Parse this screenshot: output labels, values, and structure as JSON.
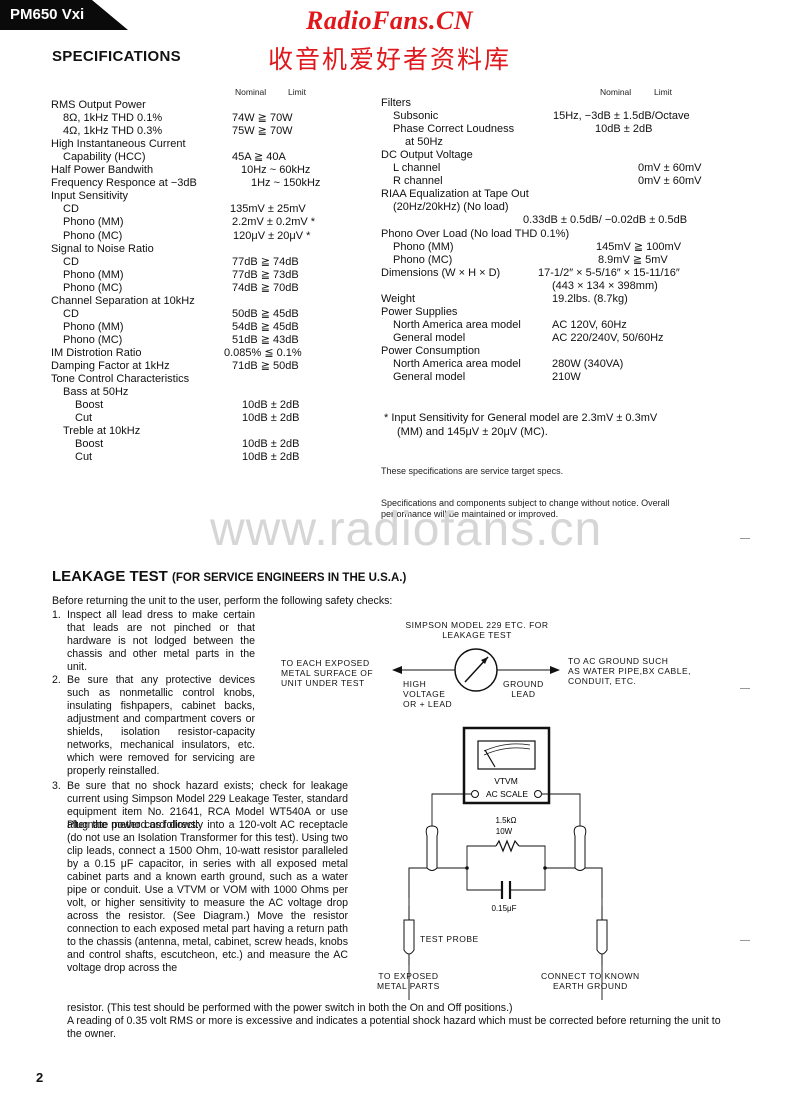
{
  "header": {
    "model": "PM650 Vxi",
    "brand_en": "RadioFans.CN",
    "brand_cn": "收音机爱好者资料库",
    "section_title": "SPECIFICATIONS"
  },
  "columns": {
    "nominal": "Nominal",
    "limit": "Limit"
  },
  "specs_left": [
    {
      "label": "RMS Output Power",
      "value": "",
      "indent": 0
    },
    {
      "label": "8Ω, 1kHz THD 0.1%",
      "value": "74W ≧ 70W",
      "indent": 1
    },
    {
      "label": "4Ω, 1kHz THD 0.3%",
      "value": "75W ≧ 70W",
      "indent": 1
    },
    {
      "label": "High Instantaneous Current",
      "value": "",
      "indent": 0
    },
    {
      "label": "Capability (HCC)",
      "value": "45A ≧ 40A",
      "indent": 1
    },
    {
      "label": "Half Power Bandwith",
      "value": "10Hz ~ 60kHz",
      "indent": 0
    },
    {
      "label": "Frequency Responce at −3dB",
      "value": "1Hz ~ 150kHz",
      "indent": 0
    },
    {
      "label": "Input Sensitivity",
      "value": "",
      "indent": 0
    },
    {
      "label": "CD",
      "value": "135mV ± 25mV",
      "indent": 1
    },
    {
      "label": "Phono (MM)",
      "value": "2.2mV ± 0.2mV *",
      "indent": 1
    },
    {
      "label": "Phono (MC)",
      "value": "120μV ± 20μV *",
      "indent": 1
    },
    {
      "label": "Signal to Noise Ratio",
      "value": "",
      "indent": 0
    },
    {
      "label": "CD",
      "value": "77dB ≧ 74dB",
      "indent": 1
    },
    {
      "label": "Phono (MM)",
      "value": "77dB ≧ 73dB",
      "indent": 1
    },
    {
      "label": "Phono (MC)",
      "value": "74dB ≧ 70dB",
      "indent": 1
    },
    {
      "label": "Channel Separation at 10kHz",
      "value": "",
      "indent": 0
    },
    {
      "label": "CD",
      "value": "50dB ≧ 45dB",
      "indent": 1
    },
    {
      "label": "Phono (MM)",
      "value": "54dB ≧ 45dB",
      "indent": 1
    },
    {
      "label": "Phono (MC)",
      "value": "51dB ≧ 43dB",
      "indent": 1
    },
    {
      "label": "IM Distrotion Ratio",
      "value": "0.085% ≦ 0.1%",
      "indent": 0
    },
    {
      "label": "Damping Factor at 1kHz",
      "value": "71dB ≧ 50dB",
      "indent": 0
    },
    {
      "label": "Tone Control Characteristics",
      "value": "",
      "indent": 0
    },
    {
      "label": "Bass at 50Hz",
      "value": "",
      "indent": 1
    },
    {
      "label": "Boost",
      "value": "10dB ± 2dB",
      "indent": 2
    },
    {
      "label": "Cut",
      "value": "10dB ± 2dB",
      "indent": 2
    },
    {
      "label": "Treble at 10kHz",
      "value": "",
      "indent": 1
    },
    {
      "label": "Boost",
      "value": "10dB ± 2dB",
      "indent": 2
    },
    {
      "label": "Cut",
      "value": "10dB ± 2dB",
      "indent": 2
    }
  ],
  "specs_right": [
    {
      "label": "Filters",
      "value": "",
      "indent": 0
    },
    {
      "label": "Subsonic",
      "value": "15Hz, −3dB ± 1.5dB/Octave",
      "indent": 1
    },
    {
      "label": "Phase Correct Loudness",
      "value": "10dB ± 2dB",
      "indent": 1
    },
    {
      "label": "at 50Hz",
      "value": "",
      "indent": 2
    },
    {
      "label": "DC Output Voltage",
      "value": "",
      "indent": 0
    },
    {
      "label": "L channel",
      "value": "0mV ± 60mV",
      "indent": 1
    },
    {
      "label": "R channel",
      "value": "0mV ± 60mV",
      "indent": 1
    },
    {
      "label": "RIAA Equalization at Tape Out",
      "value": "",
      "indent": 0
    },
    {
      "label": "(20Hz/20kHz) (No load)",
      "value": "",
      "indent": 1
    },
    {
      "label": "",
      "value": "0.33dB ± 0.5dB/ −0.02dB ± 0.5dB",
      "indent": 0
    },
    {
      "label": "Phono Over Load (No load THD 0.1%)",
      "value": "",
      "indent": 0
    },
    {
      "label": "Phono (MM)",
      "value": "145mV ≧ 100mV",
      "indent": 1
    },
    {
      "label": "Phono (MC)",
      "value": "8.9mV ≧ 5mV",
      "indent": 1
    },
    {
      "label": "Dimensions (W × H × D)",
      "value": "17-1/2″ × 5-5/16″ × 15-11/16″",
      "indent": 0
    },
    {
      "label": "",
      "value": "(443 × 134 × 398mm)",
      "indent": 0
    },
    {
      "label": "Weight",
      "value": "19.2lbs. (8.7kg)",
      "indent": 0
    },
    {
      "label": "Power Supplies",
      "value": "",
      "indent": 0
    },
    {
      "label": "North America area model",
      "value": "AC 120V, 60Hz",
      "indent": 1
    },
    {
      "label": "General model",
      "value": "AC 220/240V, 50/60Hz",
      "indent": 1
    },
    {
      "label": "Power Consumption",
      "value": "",
      "indent": 0
    },
    {
      "label": "North America area model",
      "value": "280W (340VA)",
      "indent": 1
    },
    {
      "label": "General model",
      "value": "210W",
      "indent": 1
    }
  ],
  "notes": {
    "footnote_line1": "*  Input Sensitivity for General model are 2.3mV ± 0.3mV",
    "footnote_line2": "(MM) and 145μV ± 20μV (MC).",
    "target_specs": "These specifications are service target specs.",
    "change_line1": "Specifications and components subject to change without notice. Overall",
    "change_line2": "performance will be maintained or improved."
  },
  "watermark": "www.radiofans.cn",
  "leakage": {
    "title": "LEAKAGE TEST",
    "subtitle": "(FOR SERVICE ENGINEERS IN THE U.S.A.)",
    "intro": "Before returning the unit to the user, perform the following safety checks:",
    "item1_num": "1.",
    "item1": "Inspect all lead dress to make certain that leads are not pinched or that hardware is not lodged between the chassis and other metal parts in the unit.",
    "item2_num": "2.",
    "item2": "Be sure that any protective devices such as nonmetallic control knobs, insulating fishpapers, cabinet backs, adjustment and compartment covers or shields, isolation resistor-capacity networks, mechanical insulators, etc. which were removed for servicing are properly reinstalled.",
    "item3_num": "3.",
    "item3a": "Be sure that no shock hazard exists; check for leakage current using Simpson Model 229 Leakage Tester, standard equipment item No. 21641, RCA Model WT540A or use alternate method as follows:",
    "item3b": "Plug the power cord directly into a 120-volt AC receptacle (do not use an Isolation Transformer for this test). Using two clip leads, connect a 1500 Ohm, 10-watt resistor paralleled by a 0.15 μF capacitor, in series with all exposed metal cabinet parts and a known earth ground, such as a water pipe or conduit. Use a VTVM or VOM with 1000 Ohms per volt, or higher sensitivity to measure the AC voltage drop across the resistor. (See Diagram.) Move the resistor connection to each exposed metal part having a return path to the chassis (antenna, metal, cabinet, screw heads, knobs and control shafts, escutcheon, etc.) and measure the AC voltage drop across the",
    "item3c": "resistor. (This test should be performed with the power switch in both the On and Off positions.)",
    "item3d": "A reading of 0.35 volt RMS or more is excessive and indicates a potential shock hazard which must be corrected before returning the unit to the owner."
  },
  "diagram": {
    "tester_title_1": "SIMPSON MODEL 229 ETC. FOR",
    "tester_title_2": "LEAKAGE TEST",
    "left_target_1": "TO EACH EXPOSED",
    "left_target_2": "METAL SURFACE OF",
    "left_target_3": "UNIT UNDER TEST",
    "high_lead_1": "HIGH",
    "high_lead_2": "VOLTAGE",
    "high_lead_3": "OR + LEAD",
    "ground_lead_1": "GROUND",
    "ground_lead_2": "LEAD",
    "right_target_1": "TO AC GROUND SUCH",
    "right_target_2": "AS WATER PIPE,BX CABLE,",
    "right_target_3": "CONDUIT, ETC.",
    "vtvm_1": "VTVM",
    "vtvm_2": "AC SCALE",
    "resistor_1": "1.5kΩ",
    "resistor_2": "10W",
    "capacitor": "0.15μF",
    "test_probe": "TEST PROBE",
    "exposed_1": "TO EXPOSED",
    "exposed_2": "METAL PARTS",
    "earth_1": "CONNECT TO KNOWN",
    "earth_2": "EARTH GROUND"
  },
  "page_number": "2"
}
